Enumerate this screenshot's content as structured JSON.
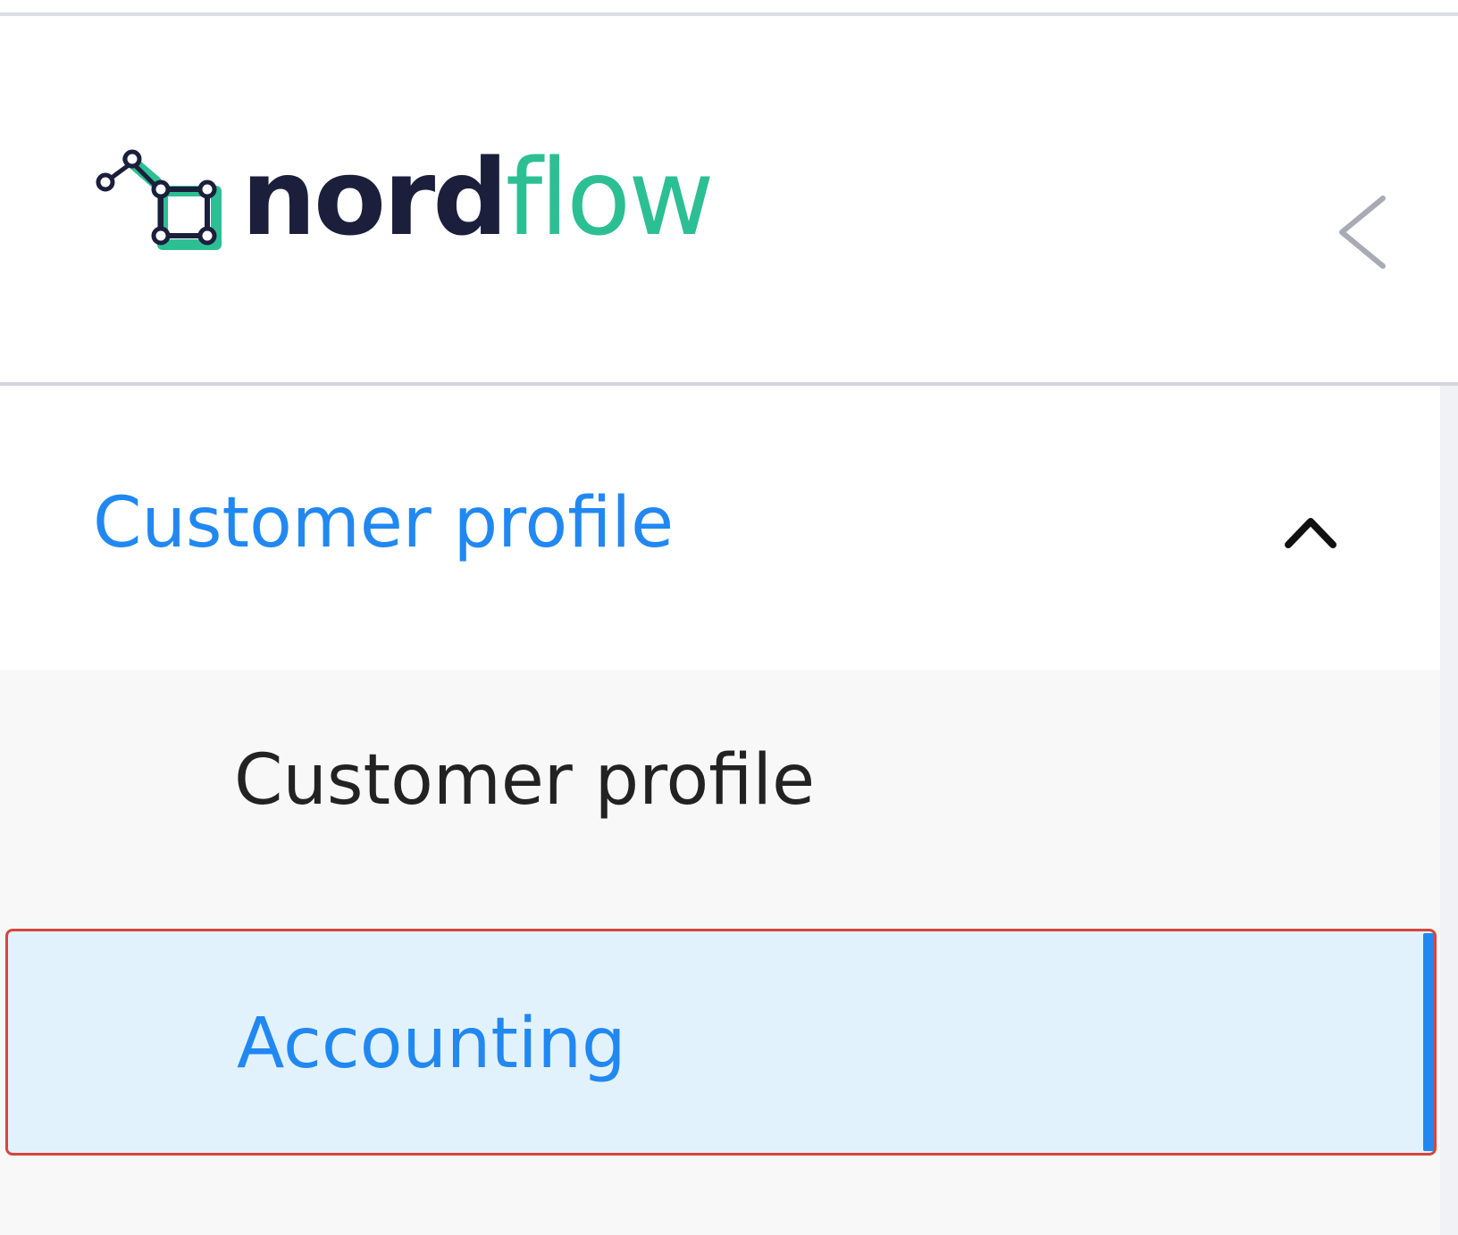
{
  "brand": {
    "name_primary": "nord",
    "name_secondary": "flow",
    "logo_icon": "nordflow-logo-icon",
    "primary_color": "#1b1f3b",
    "secondary_color": "#2dbf94"
  },
  "sidebar": {
    "collapse_icon": "chevron-left-icon",
    "group": {
      "label": "Customer profile",
      "expanded": true,
      "icon": "chevron-up-icon",
      "color": "#2188f2"
    },
    "items": [
      {
        "label": "Customer profile",
        "active": false
      },
      {
        "label": "Accounting",
        "active": true
      }
    ],
    "active_color": "#2188f2",
    "active_background": "#e2f2fc"
  }
}
